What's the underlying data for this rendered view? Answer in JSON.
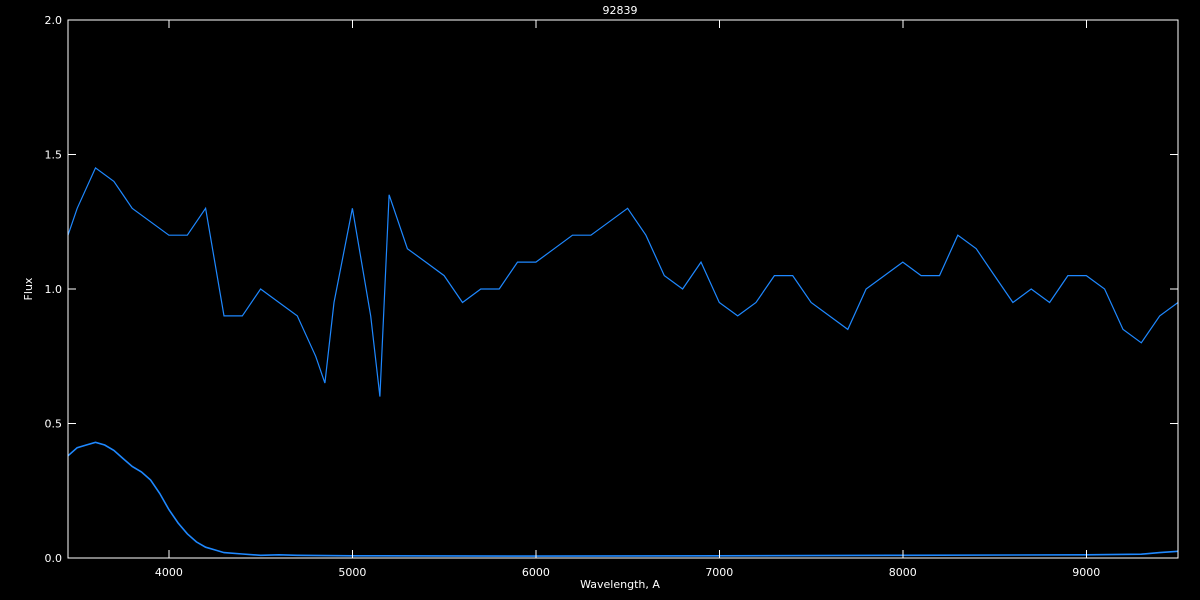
{
  "chart_data": {
    "type": "line",
    "title": "92839",
    "xlabel": "Wavelength, A",
    "ylabel": "Flux",
    "xlim": [
      3450,
      9500
    ],
    "ylim": [
      0.0,
      2.0
    ],
    "x_ticks": [
      4000,
      5000,
      6000,
      7000,
      8000,
      9000
    ],
    "x_tick_labels": [
      "4000",
      "5000",
      "6000",
      "7000",
      "8000",
      "9000"
    ],
    "y_ticks": [
      0.0,
      0.5,
      1.0,
      1.5,
      2.0
    ],
    "y_tick_labels": [
      "0.0",
      "0.5",
      "1.0",
      "1.5",
      "2.0"
    ],
    "grid": false,
    "background": "#000000",
    "axis_color": "#ffffff",
    "series": [
      {
        "color": "#1e88ff",
        "x": [
          3450,
          3500,
          3600,
          3700,
          3800,
          3900,
          4000,
          4100,
          4200,
          4300,
          4400,
          4500,
          4600,
          4700,
          4800,
          4850,
          4900,
          5000,
          5100,
          5150,
          5200,
          5300,
          5400,
          5500,
          5600,
          5700,
          5800,
          5900,
          6000,
          6100,
          6200,
          6300,
          6400,
          6500,
          6600,
          6700,
          6800,
          6900,
          7000,
          7100,
          7200,
          7300,
          7400,
          7500,
          7600,
          7700,
          7800,
          7900,
          8000,
          8100,
          8200,
          8300,
          8400,
          8500,
          8600,
          8700,
          8800,
          8900,
          9000,
          9100,
          9200,
          9300,
          9400,
          9500
        ],
        "values": [
          1.2,
          1.3,
          1.45,
          1.4,
          1.3,
          1.25,
          1.2,
          1.2,
          1.3,
          0.9,
          0.9,
          1.0,
          0.95,
          0.9,
          0.75,
          0.65,
          0.95,
          1.3,
          0.9,
          0.6,
          1.35,
          1.15,
          1.1,
          1.05,
          0.95,
          1.0,
          1.0,
          1.1,
          1.1,
          1.15,
          1.2,
          1.2,
          1.25,
          1.3,
          1.2,
          1.05,
          1.0,
          1.1,
          0.95,
          0.9,
          0.95,
          1.05,
          1.05,
          0.95,
          0.9,
          0.85,
          1.0,
          1.05,
          1.1,
          1.05,
          1.05,
          1.2,
          1.15,
          1.05,
          0.95,
          1.0,
          0.95,
          1.05,
          1.05,
          1.0,
          0.85,
          0.8,
          0.9,
          0.95
        ]
      },
      {
        "color": "#1e88ff",
        "x": [
          3450,
          3500,
          3550,
          3600,
          3650,
          3700,
          3750,
          3800,
          3850,
          3900,
          3950,
          4000,
          4050,
          4100,
          4150,
          4200,
          4250,
          4300,
          4400,
          4500,
          4600,
          4700,
          5000,
          6000,
          7000,
          8000,
          9000,
          9300,
          9400,
          9500
        ],
        "values": [
          0.38,
          0.41,
          0.42,
          0.43,
          0.42,
          0.4,
          0.37,
          0.34,
          0.32,
          0.29,
          0.24,
          0.18,
          0.13,
          0.09,
          0.06,
          0.04,
          0.03,
          0.02,
          0.015,
          0.01,
          0.012,
          0.01,
          0.008,
          0.007,
          0.008,
          0.01,
          0.012,
          0.014,
          0.02,
          0.025
        ]
      }
    ]
  }
}
